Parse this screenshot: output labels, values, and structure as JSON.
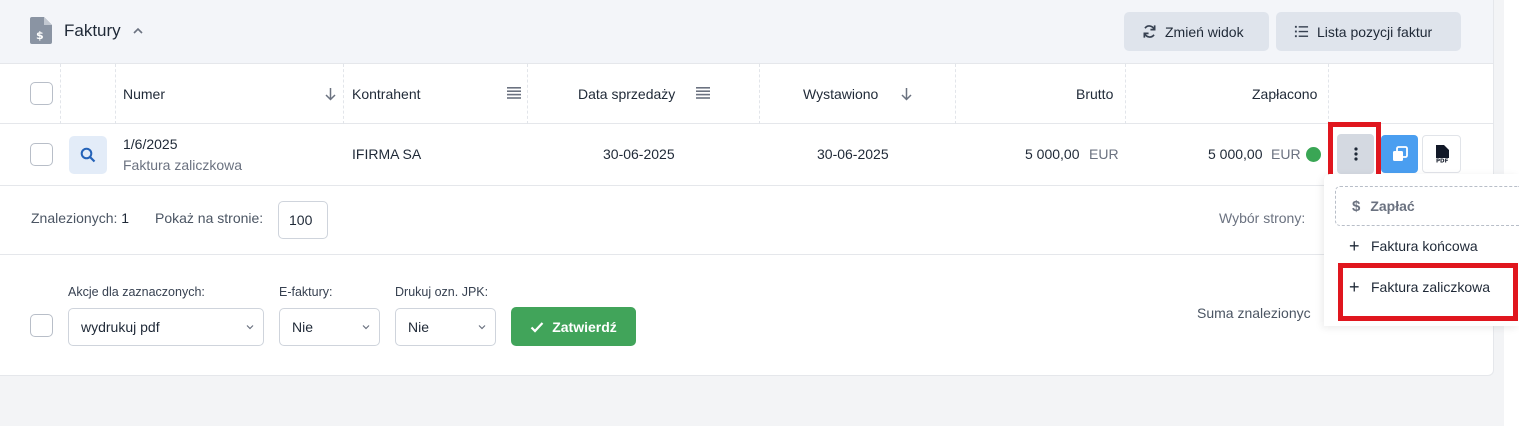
{
  "header": {
    "title": "Faktury",
    "btn_change_view": "Zmień widok",
    "btn_list_items": "Lista pozycji faktur"
  },
  "table": {
    "columns": {
      "numer": "Numer",
      "kontrahent": "Kontrahent",
      "data_sprzedazy": "Data sprzedaży",
      "wystawiono": "Wystawiono",
      "brutto": "Brutto",
      "zaplacono": "Zapłacono"
    },
    "rows": [
      {
        "numer": "1/6/2025",
        "typ": "Faktura zaliczkowa",
        "kontrahent": "IFIRMA SA",
        "data_sprzedazy": "30-06-2025",
        "wystawiono": "30-06-2025",
        "brutto_amount": "5 000,00",
        "brutto_currency": "EUR",
        "zaplacono_amount": "5 000,00",
        "zaplacono_currency": "EUR",
        "status_color": "#3aa655"
      }
    ]
  },
  "pagination": {
    "found_label": "Znalezionych:",
    "found_count": "1",
    "per_page_label": "Pokaż na stronie:",
    "per_page_value": "100",
    "page_pick_label": "Wybór strony:"
  },
  "bulk": {
    "actions_label": "Akcje dla zaznaczonych:",
    "actions_value": "wydrukuj pdf",
    "efaktury_label": "E-faktury:",
    "efaktury_value": "Nie",
    "jpk_label": "Drukuj ozn. JPK:",
    "jpk_value": "Nie",
    "confirm_label": "Zatwierdź",
    "sum_label": "Suma znalezionyc"
  },
  "dropdown": {
    "pay": "Zapłać",
    "final_invoice": "Faktura końcowa",
    "advance_invoice": "Faktura zaliczkowa"
  },
  "colors": {
    "accent_blue": "#4a9ef0",
    "confirm_green": "#41a45a",
    "highlight_red": "#e0161e"
  }
}
